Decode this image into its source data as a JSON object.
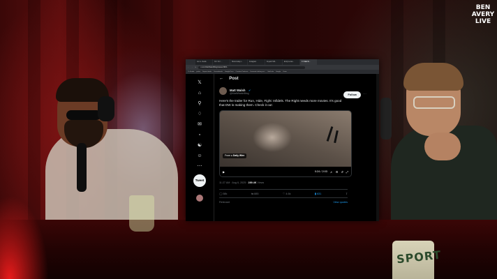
{
  "overlay": {
    "logo_lines": [
      "BEN",
      "AVERY",
      "LIVE"
    ],
    "mug_text": "SPORT"
  },
  "browser": {
    "tabs": [
      "Go to - Redis",
      "X3 / X4 / ...",
      "Show today o...",
      "Instagram",
      "Kuyash SW...",
      "Emily Lucas...",
      "X / Matt W..."
    ],
    "url": "x.com/MattWalshBlog/status/1953...",
    "bookmarks": [
      "Tx Studio",
      "jacket",
      "Deposit deals",
      "Screenbooks",
      "Google Docs",
      "Creative Podcasts",
      "Featured clothing art...",
      "Stuff ride",
      "Google",
      "Ozzie"
    ]
  },
  "sidebar": {
    "icons": [
      "x-logo-icon",
      "home-icon",
      "search-icon",
      "notifications-icon",
      "messages-icon",
      "grok-icon",
      "communities-icon",
      "profile-icon",
      "more-icon"
    ],
    "tweet_label": "Tweet"
  },
  "post": {
    "header": "Post",
    "author_name": "Matt Walsh",
    "author_handle": "@MattWalshBlog",
    "follow_label": "Follow",
    "text": "Here's the trailer for Run, Hide, Fight: Infidels. The Right needs more movies. It's good that DW is making them. Check it out:",
    "media": {
      "from_label": "From",
      "from_source": "Daily Wire",
      "time": "0:24 / 2:03"
    },
    "timestamp": "11:27 AM · Aug 6, 2025 · ",
    "views_count": "289.4K",
    "views_label": "Views",
    "actions": {
      "replies": "58k",
      "reposts": "885",
      "likes": "4.6k",
      "bookmarks": "631"
    },
    "relevant_label": "Relevant",
    "view_quotes_label": "View quotes"
  },
  "colors": {
    "accent": "#1d9bf0",
    "background": "#000000",
    "text": "#e7e9ea",
    "muted": "#71767b"
  }
}
